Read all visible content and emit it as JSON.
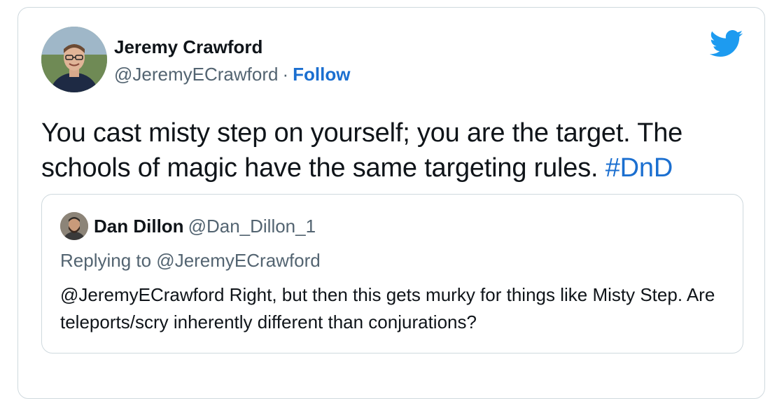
{
  "tweet": {
    "author": {
      "name": "Jeremy Crawford",
      "handle": "@JeremyECrawford",
      "separator": "·",
      "follow_label": "Follow"
    },
    "text": "You cast misty step on yourself; you are the target. The schools of magic have the same targeting rules. ",
    "hashtag": "#DnD",
    "brand_icon": "twitter-bird-icon",
    "colors": {
      "link": "#1b6fd0",
      "brand": "#1d9bf0",
      "text": "#0f1419",
      "muted": "#536471",
      "border": "#cfd9de"
    }
  },
  "quoted": {
    "author": {
      "name": "Dan Dillon",
      "handle": "@Dan_Dillon_1"
    },
    "replying_to": "Replying to @JeremyECrawford",
    "text": "@JeremyECrawford Right, but then this gets murky for things like Misty Step. Are teleports/scry inherently different than conjurations?"
  }
}
